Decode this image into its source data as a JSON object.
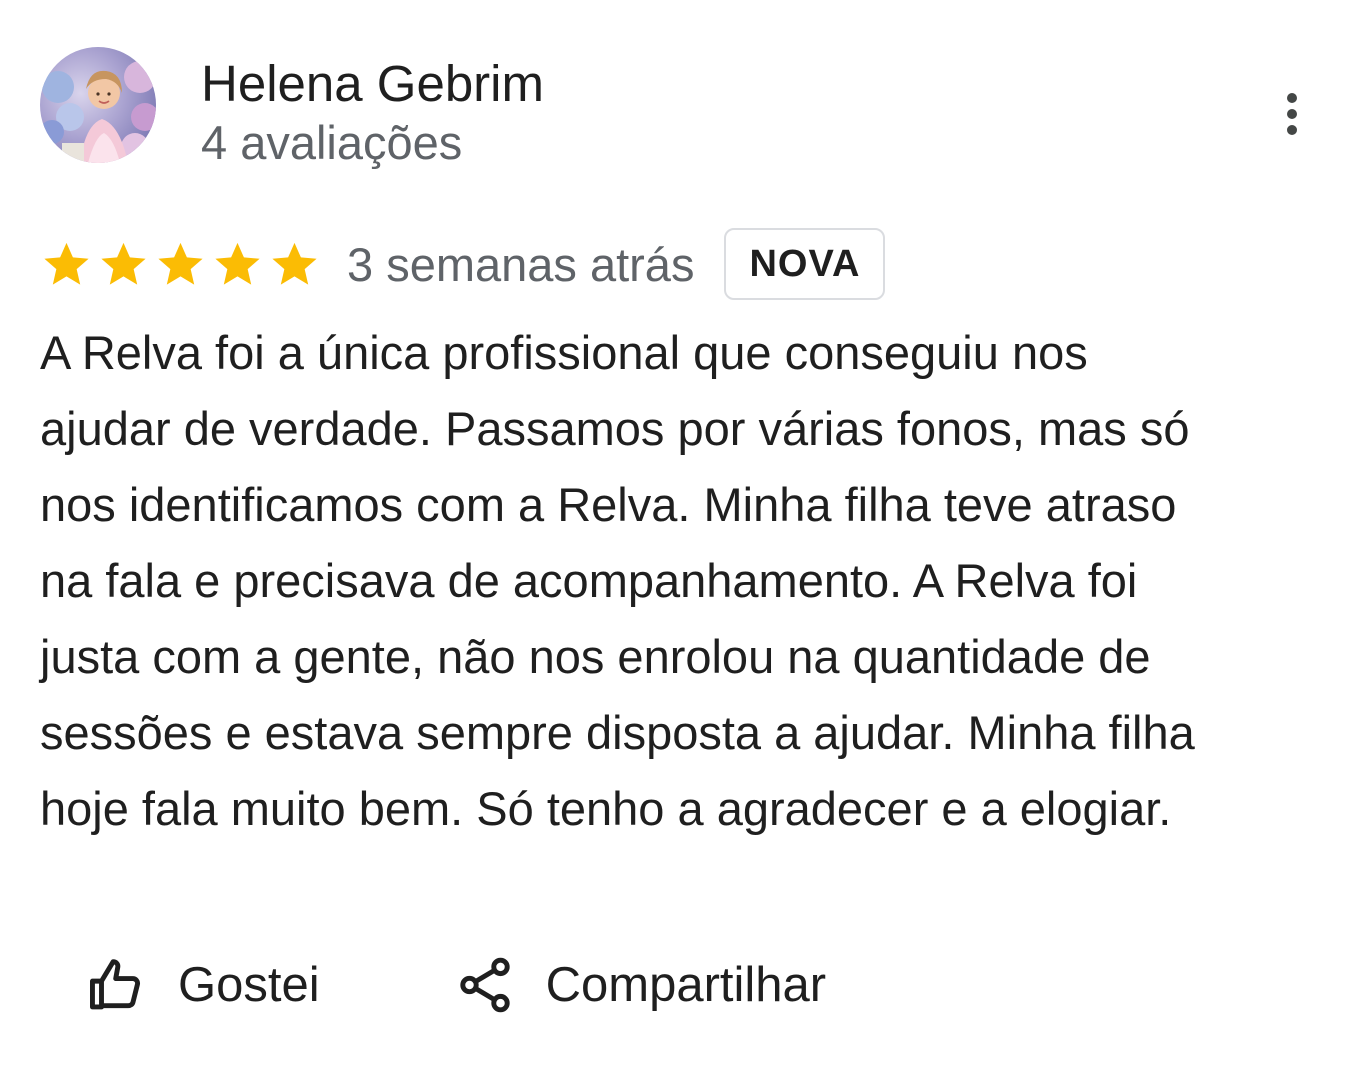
{
  "review": {
    "author": {
      "name": "Helena Gebrim",
      "review_count": "4 avaliações",
      "avatar_icon": "profile-photo"
    },
    "rating": 5,
    "rating_max": 5,
    "date": "3 semanas atrás",
    "badge": "NOVA",
    "text_lines": [
      "A Relva foi a única profissional que conseguiu nos",
      "ajudar de verdade. Passamos por várias fonos, mas só",
      "nos identificamos com a Relva. Minha filha teve atraso",
      "na fala e precisava de acompanhamento. A Relva foi",
      "justa com a gente, não nos enrolou na quantidade de",
      "sessões e estava sempre disposta a ajudar. Minha filha",
      "hoje fala muito bem. Só tenho a agradecer e a elogiar."
    ]
  },
  "actions": {
    "like_label": "Gostei",
    "like_icon": "thumbs-up-icon",
    "share_label": "Compartilhar",
    "share_icon": "share-icon",
    "more_icon": "more-vertical-icon"
  },
  "colors": {
    "star": "#fbbc04",
    "text_primary": "#1f1f1f",
    "text_secondary": "#5f6368",
    "badge_border": "#dadce0"
  }
}
